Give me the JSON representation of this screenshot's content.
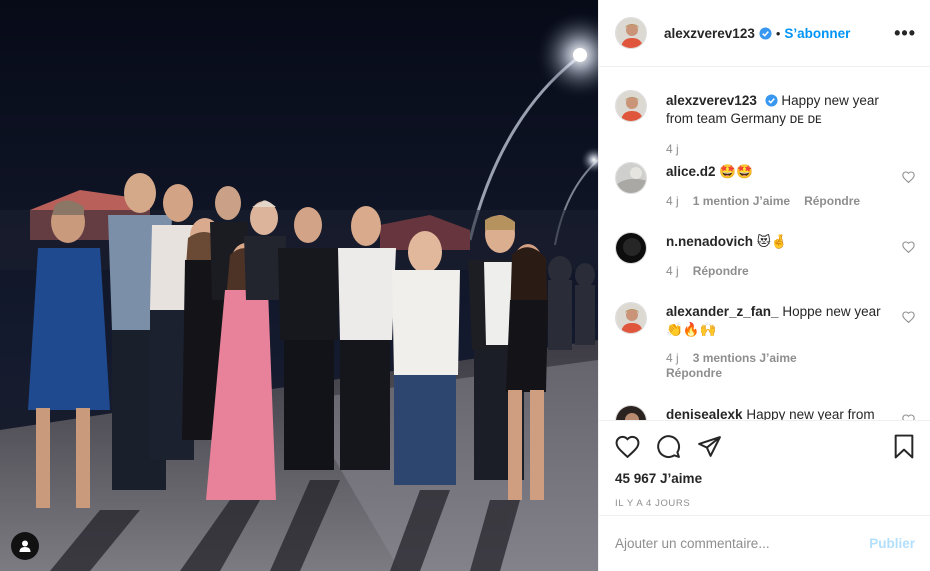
{
  "post": {
    "username": "alexzverev123",
    "follow_label": "S’abonner",
    "dot": "•",
    "more": "•••"
  },
  "caption": {
    "username": "alexzverev123",
    "text": "Happy new year from team Germany",
    "flags": "ᴅᴇ ᴅᴇ",
    "time": "4 j"
  },
  "comments": [
    {
      "username": "alice.d2",
      "text": "🤩🤩",
      "time": "4 j",
      "likes": "1 mention J’aime",
      "reply": "Répondre"
    },
    {
      "username": "n.nenadovich",
      "text": "😻🤞",
      "time": "4 j",
      "likes": "",
      "reply": "Répondre"
    },
    {
      "username": "alexander_z_fan_",
      "text": "Hoppe new year👏🔥🙌",
      "time": "4 j",
      "likes": "3 mentions J’aime",
      "reply": "Répondre"
    },
    {
      "username": "denisealexk",
      "text": "Happy new year from",
      "time": "",
      "likes": "",
      "reply": ""
    }
  ],
  "stats": {
    "likes": "45 967 J’aime",
    "ago": "IL Y A 4 JOURS"
  },
  "composer": {
    "placeholder": "Ajouter un commentaire...",
    "post_label": "Publier"
  },
  "icons": [
    "heart-icon",
    "comment-icon",
    "share-icon",
    "bookmark-icon",
    "user-tag-icon",
    "verified-icon",
    "more-icon"
  ],
  "colors": {
    "accent": "#0095f6",
    "publish_disabled": "#b2dffc",
    "muted": "#8e8e8e",
    "verified": "#3897f0"
  }
}
